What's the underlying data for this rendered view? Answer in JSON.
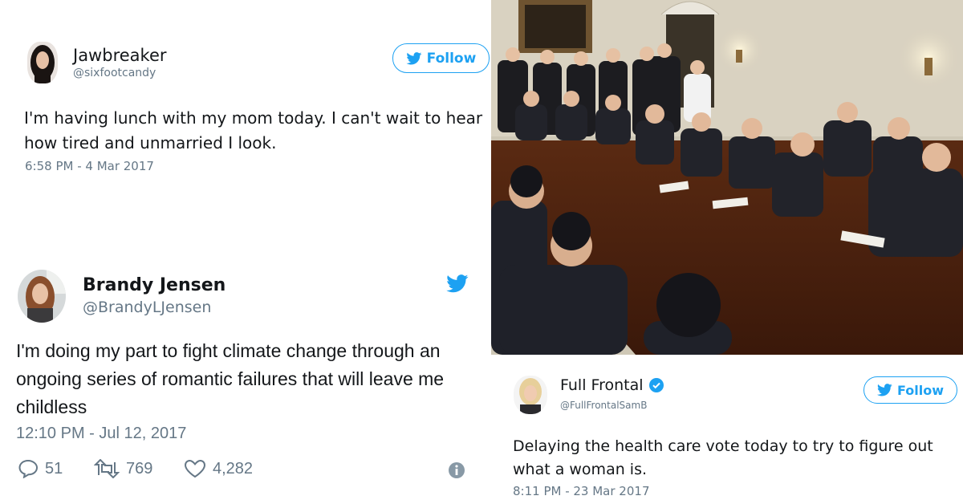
{
  "tweet1": {
    "name": "Jawbreaker",
    "handle": "@sixfootcandy",
    "follow_label": "Follow",
    "text": "I'm having lunch with my mom today. I can't wait to hear how tired and unmarried I look.",
    "timestamp": "6:58 PM - 4 Mar 2017"
  },
  "tweet2": {
    "name": "Brandy Jensen",
    "handle": "@BrandyLJensen",
    "text": "I'm doing my part to fight climate change through an ongoing series of romantic failures that will leave me childless",
    "timestamp": "12:10 PM - Jul 12, 2017",
    "replies": "51",
    "retweets": "769",
    "likes": "4,282"
  },
  "tweet3": {
    "name": "Full Frontal",
    "handle": "@FullFrontalSamB",
    "follow_label": "Follow",
    "text": "Delaying the health care vote today to try to figure out what a woman is.",
    "timestamp": "8:11 PM - 23 Mar 2017"
  },
  "colors": {
    "twitter_blue": "#1da1f2",
    "text_primary": "#14171a",
    "text_secondary": "#657786",
    "verified_badge": "#1da1f2"
  },
  "icons": {
    "bird": "twitter-bird-icon",
    "reply": "reply-icon",
    "retweet": "retweet-icon",
    "like": "heart-icon",
    "info": "info-icon",
    "verified": "verified-badge-icon"
  }
}
